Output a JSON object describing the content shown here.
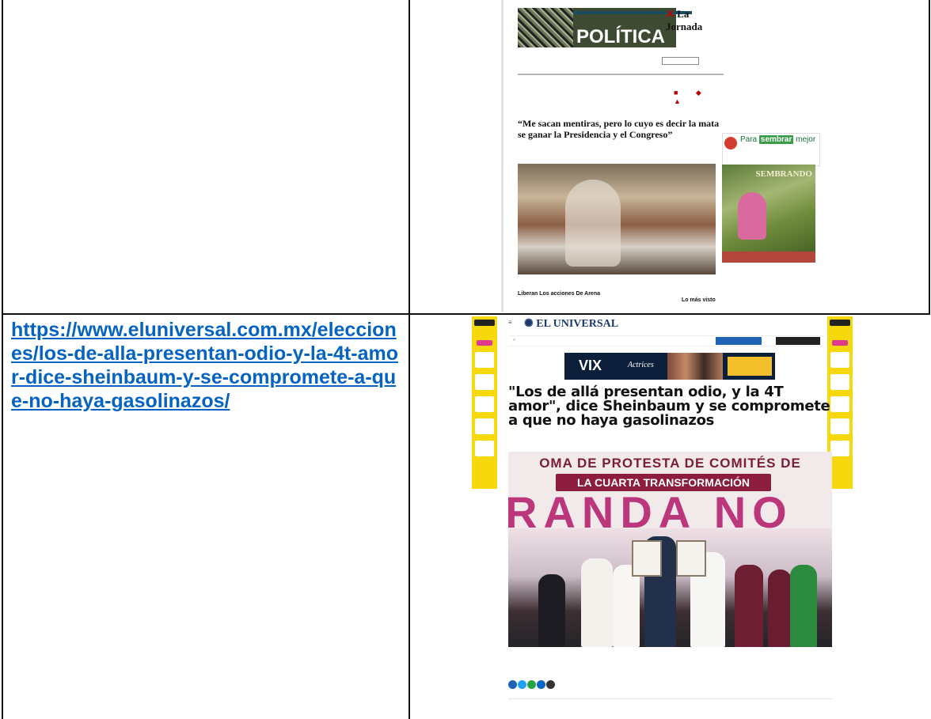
{
  "url_link": "https://www.eluniversal.com.mx/elecciones/los-de-alla-presentan-odio-y-la-4t-amor-dice-sheinbaum-y-se-compromete-a-que-no-haya-gasolinazos/",
  "jornada": {
    "logo": "La Jornada",
    "section": "POLÍTICA",
    "headline": "“Me sacan mentiras, pero lo cuyo es decir la mata se ganar la Presidencia y el Congreso”",
    "ad_text": "Para",
    "ad_highlight": "sembrar",
    "ad_tail": "mejor",
    "sembrando_label": "SEMBRANDO",
    "sub_heading": "Liberan Los acciones De Arena",
    "aside_title": "Lo más visto"
  },
  "universal": {
    "logo": "EL UNIVERSAL",
    "ad_vix": "VIX",
    "ad_show": "Actrices",
    "headline": "\"Los de allá presentan odio, y la 4T amor\", dice Sheinbaum y se compromete a que no haya gasolinazos",
    "banner_line1": "OMA DE PROTESTA DE COMITÉS DE",
    "banner_line2": "LA CUARTA TRANSFORMACIÓN",
    "big_letters": "RANDA NO"
  },
  "colors": {
    "link": "#0563c1",
    "jornada_red": "#c00000",
    "universal_blue": "#1a3a6d",
    "banner_pink": "#b72771"
  }
}
